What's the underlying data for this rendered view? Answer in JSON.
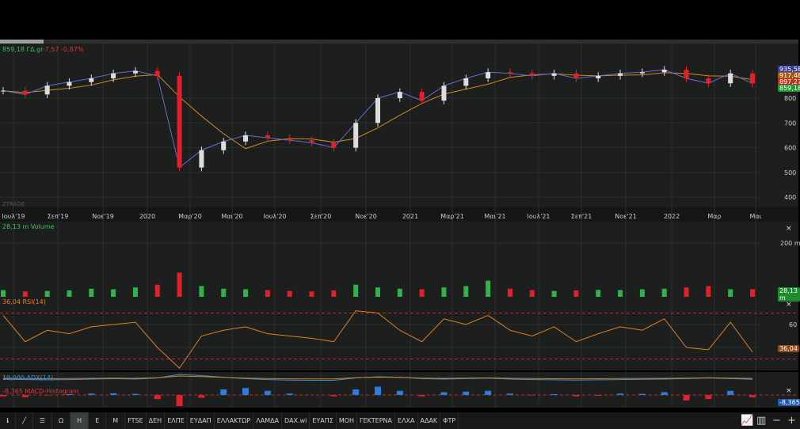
{
  "header": {
    "quote": "859,18 ΓΔ.gr",
    "change": "-7,57 -0,87%"
  },
  "watermark": "ZTRADE",
  "colors": {
    "up": "#2fb34a",
    "down": "#e0202a",
    "ma": "#d08a20",
    "rsi": "#e07f20",
    "grid": "#2a2f2d",
    "bg": "#1c1f1e"
  },
  "chart_data": [
    {
      "type": "candlestick",
      "name": "price",
      "yticks": [
        400,
        500,
        600,
        700,
        800
      ],
      "ylim": [
        360,
        960
      ],
      "xticks": [
        "Ιουλ'19",
        "Σεπ'19",
        "Νοε'19",
        "2020",
        "Μαρ'20",
        "Μαι'20",
        "Ιουλ'20",
        "Σεπ'20",
        "Νοε'20",
        "2021",
        "Μαρ'21",
        "Μαι'21",
        "Ιουλ'21",
        "Σεπ'21",
        "Νοε'21",
        "2022",
        "Μαρ",
        "Μαι"
      ],
      "close": [
        830,
        815,
        850,
        865,
        880,
        900,
        910,
        890,
        520,
        590,
        625,
        650,
        640,
        630,
        620,
        600,
        700,
        800,
        825,
        790,
        850,
        880,
        905,
        900,
        890,
        900,
        880,
        890,
        900,
        905,
        915,
        880,
        860,
        900,
        859.18
      ],
      "last_labels": [
        "935,58",
        "917,48",
        "897,27",
        "859,18"
      ]
    },
    {
      "type": "bar",
      "name": "Volume",
      "label": "28,13 m Volume",
      "yticks": [
        "200 m"
      ],
      "ylim": [
        0,
        280
      ],
      "values": [
        25,
        20,
        22,
        24,
        30,
        28,
        35,
        45,
        90,
        40,
        30,
        28,
        25,
        22,
        20,
        24,
        45,
        35,
        30,
        28,
        35,
        40,
        60,
        30,
        25,
        22,
        24,
        26,
        25,
        28,
        30,
        35,
        40,
        28,
        28.13
      ],
      "last_label": "28,13 m"
    },
    {
      "type": "line",
      "name": "RSI",
      "label": "36,04 RSI(14)",
      "yticks": [
        40,
        60
      ],
      "levels": [
        30,
        70
      ],
      "ylim": [
        20,
        80
      ],
      "values": [
        68,
        45,
        55,
        52,
        58,
        60,
        62,
        40,
        22,
        50,
        55,
        58,
        52,
        50,
        48,
        45,
        72,
        70,
        55,
        45,
        65,
        60,
        68,
        55,
        50,
        58,
        45,
        52,
        58,
        55,
        65,
        40,
        38,
        62,
        36.04
      ],
      "last_label": "36,04"
    },
    {
      "type": "line",
      "name": "ADX",
      "label": "19,000 ADX(14)",
      "values": [
        20,
        18,
        17,
        18,
        20,
        22,
        20,
        25,
        40,
        35,
        28,
        22,
        18,
        16,
        15,
        15,
        25,
        30,
        28,
        22,
        20,
        22,
        24,
        20,
        18,
        17,
        16,
        17,
        18,
        19,
        20,
        22,
        25,
        22,
        19
      ]
    },
    {
      "type": "bar",
      "name": "MACD-Histogram",
      "label": "-8,365 MACD-Histogram",
      "values": [
        -5,
        -8,
        -2,
        3,
        5,
        6,
        4,
        -15,
        -40,
        -10,
        20,
        25,
        15,
        5,
        0,
        -5,
        20,
        30,
        15,
        -5,
        10,
        12,
        15,
        5,
        -2,
        3,
        -5,
        -3,
        5,
        4,
        10,
        -20,
        -15,
        15,
        -8.365
      ],
      "last_label": "-8,365"
    }
  ],
  "toolbar": {
    "items": [
      "Ω",
      "Η",
      "Ε",
      "Μ",
      "FTSE",
      "ΔΕΗ",
      "ΕΛΠΕ",
      "ΕΥΔΑΠ",
      "ΕΛΛΑΚΤΩΡ",
      "ΛΑΜΔΑ",
      "DAX.wi",
      "ΕΥΑΠΣ",
      "ΜΟΗ",
      "ΓΕΚΤΕΡΝΑ",
      "ΕΛΧΑ",
      "ΑΔΑΚ",
      "ΦΤΡ"
    ],
    "active": "Η"
  },
  "close_symbol": "×"
}
